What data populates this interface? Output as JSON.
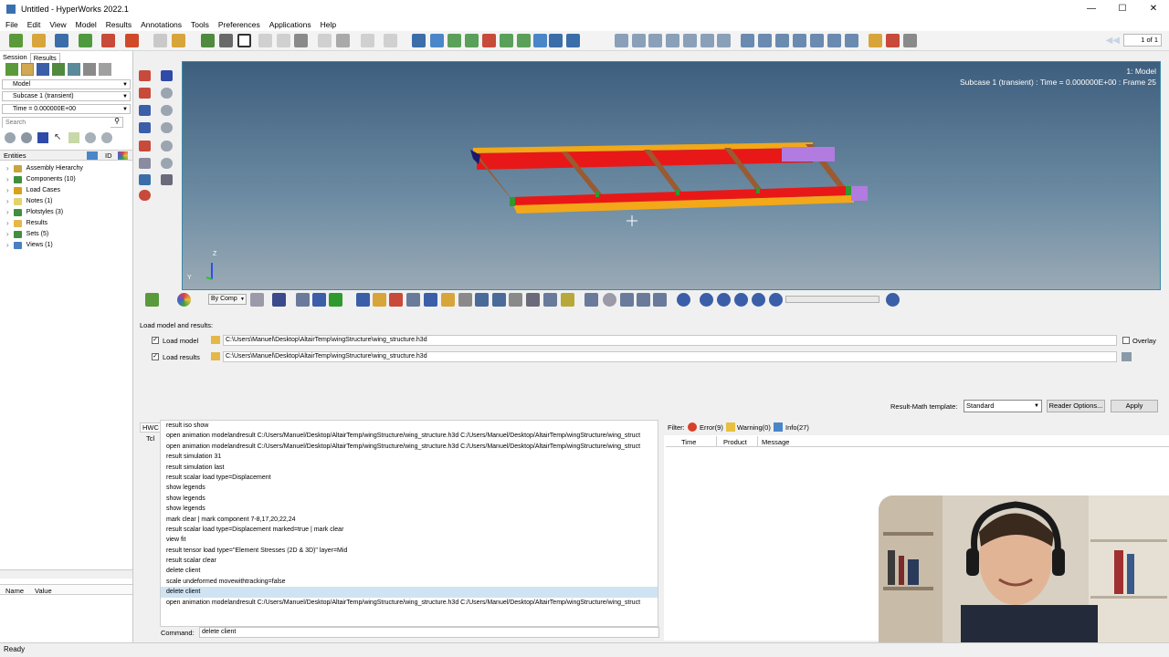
{
  "window": {
    "title": "Untitled - HyperWorks 2022.1",
    "minimize": "—",
    "maximize": "☐",
    "close": "✕"
  },
  "menu": [
    "File",
    "Edit",
    "View",
    "Model",
    "Results",
    "Annotations",
    "Tools",
    "Preferences",
    "Applications",
    "Help"
  ],
  "pager": {
    "value": "1 of 1"
  },
  "left_panel": {
    "tabs": [
      "Session",
      "Results"
    ],
    "model_select": "Model",
    "subcase_select": "Subcase 1 (transient)",
    "time_select": "Time = 0.000000E+00",
    "search_placeholder": "Search",
    "entities_header": "Entities",
    "id_header": "ID",
    "tree": [
      {
        "label": "Assembly Hierarchy",
        "color": "#c8a53a"
      },
      {
        "label": "Components (10)",
        "color": "#3f8f3f"
      },
      {
        "label": "Load Cases",
        "color": "#d7a21a"
      },
      {
        "label": "Notes (1)",
        "color": "#e2d36b"
      },
      {
        "label": "Plotstyles (3)",
        "color": "#3f8f3f"
      },
      {
        "label": "Results",
        "color": "#e6b84a"
      },
      {
        "label": "Sets (5)",
        "color": "#3f8f3f"
      },
      {
        "label": "Views (1)",
        "color": "#4a80c0"
      }
    ],
    "prop_headers": [
      "Name",
      "Value"
    ]
  },
  "viewport": {
    "info_line1": "1: Model",
    "info_line2": "Subcase 1 (transient) : Time = 0.000000E+00 : Frame 25",
    "axis_z": "Z",
    "axis_y": "Y"
  },
  "bottom_toolbar": {
    "by_comp": "By Comp"
  },
  "load_panel": {
    "heading": "Load model and results:",
    "load_model_label": "Load model",
    "load_model_path": "C:\\Users\\Manuel\\Desktop\\AltairTemp\\wingStructure\\wing_structure.h3d",
    "load_results_label": "Load results",
    "load_results_path": "C:\\Users\\Manuel\\Desktop\\AltairTemp\\wingStructure\\wing_structure.h3d",
    "overlay_label": "Overlay",
    "template_label": "Result-Math template:",
    "template_value": "Standard",
    "reader_options": "Reader Options...",
    "apply": "Apply",
    "checkmark": "✓"
  },
  "console": {
    "tabs": [
      "HWC",
      "Tcl"
    ],
    "commands": [
      "result iso show",
      "open animation modelandresult C:/Users/Manuel/Desktop/AltairTemp/wingStructure/wing_structure.h3d C:/Users/Manuel/Desktop/AltairTemp/wingStructure/wing_struct",
      "open animation modelandresult C:/Users/Manuel/Desktop/AltairTemp/wingStructure/wing_structure.h3d C:/Users/Manuel/Desktop/AltairTemp/wingStructure/wing_struct",
      "result simulation 31",
      "result simulation last",
      "result scalar load type=Displacement",
      "show legends",
      "show legends",
      "show legends",
      "mark clear | mark component 7-8,17,20,22,24",
      "result scalar load type=Displacement marked=true | mark clear",
      "view fit",
      "result tensor load type=\"Element Stresses (2D & 3D)\" layer=Mid",
      "result scalar clear",
      "delete client",
      "scale undeformed movewithtracking=false",
      "delete client",
      "open animation modelandresult C:/Users/Manuel/Desktop/AltairTemp/wingStructure/wing_structure.h3d C:/Users/Manuel/Desktop/AltairTemp/wingStructure/wing_struct"
    ],
    "highlight_index": 16,
    "command_label": "Command:",
    "command_value": "delete client"
  },
  "messages": {
    "filter_label": "Filter:",
    "error": "Error(9)",
    "warning": "Warning(0)",
    "info": "Info(27)",
    "columns": [
      "Time",
      "Product",
      "Message"
    ]
  },
  "status": "Ready",
  "colors": {
    "viewport_top": "#3d5e7e",
    "spar_red": "#e81818",
    "flange_yellow": "#f2a818",
    "rib_brown": "#9a5a32",
    "pin_purple": "#b27be0"
  }
}
